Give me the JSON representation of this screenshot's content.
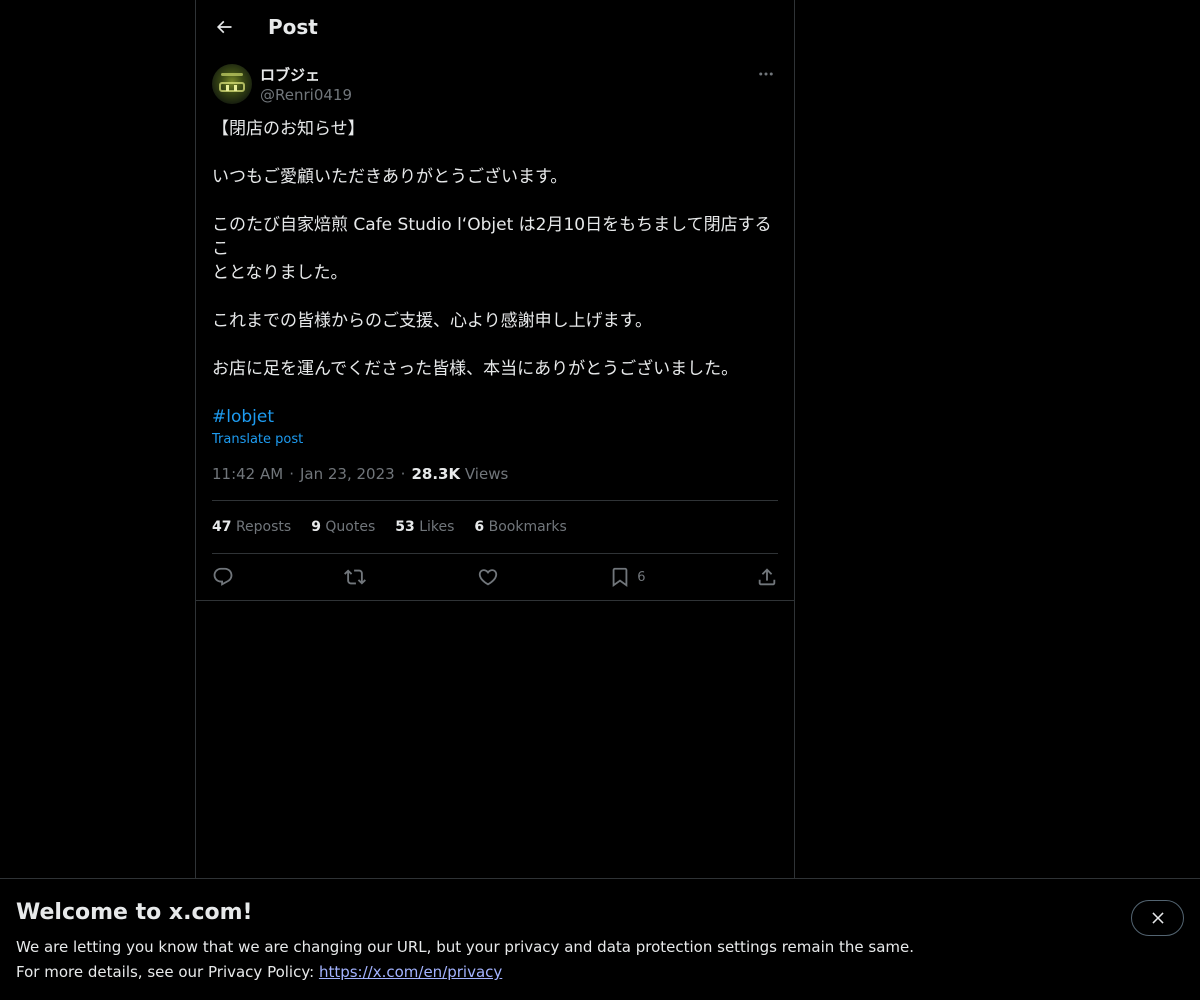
{
  "header": {
    "title": "Post"
  },
  "post": {
    "author_name": "ロブジェ",
    "author_handle": "@Renri0419",
    "lines": [
      "【閉店のお知らせ】",
      "",
      "いつもご愛顧いただきありがとうございます。",
      "",
      "このたび自家焙煎 Cafe Studio lʻObjet は2月10日をもちまして閉店するこ",
      "ととなりました。",
      "",
      "これまでの皆様からのご支援、心より感謝申し上げます。",
      "",
      "お店に足を運んでくださった皆様、本当にありがとうございました。",
      ""
    ],
    "hashtag": "#lobjet",
    "translate_label": "Translate post",
    "time": "11:42 AM",
    "date": "Jan 23, 2023",
    "views_count": "28.3K",
    "views_label": "Views"
  },
  "stats": [
    {
      "count": "47",
      "label": "Reposts"
    },
    {
      "count": "9",
      "label": "Quotes"
    },
    {
      "count": "53",
      "label": "Likes"
    },
    {
      "count": "6",
      "label": "Bookmarks"
    }
  ],
  "actions": {
    "icons": [
      "reply-icon",
      "repost-icon",
      "like-icon",
      "bookmark-icon",
      "share-icon"
    ],
    "bookmark_count": "6"
  },
  "banner": {
    "title": "Welcome to x.com!",
    "line1": "We are letting you know that we are changing our URL, but your privacy and data protection settings remain the same.",
    "line2_prefix": "For more details, see our Privacy Policy: ",
    "link": "https://x.com/en/privacy"
  },
  "colors": {
    "background": "#000000",
    "text": "#e7e9ea",
    "secondary_text": "#71767b",
    "accent": "#1d9bf0",
    "border": "#2f3336"
  }
}
